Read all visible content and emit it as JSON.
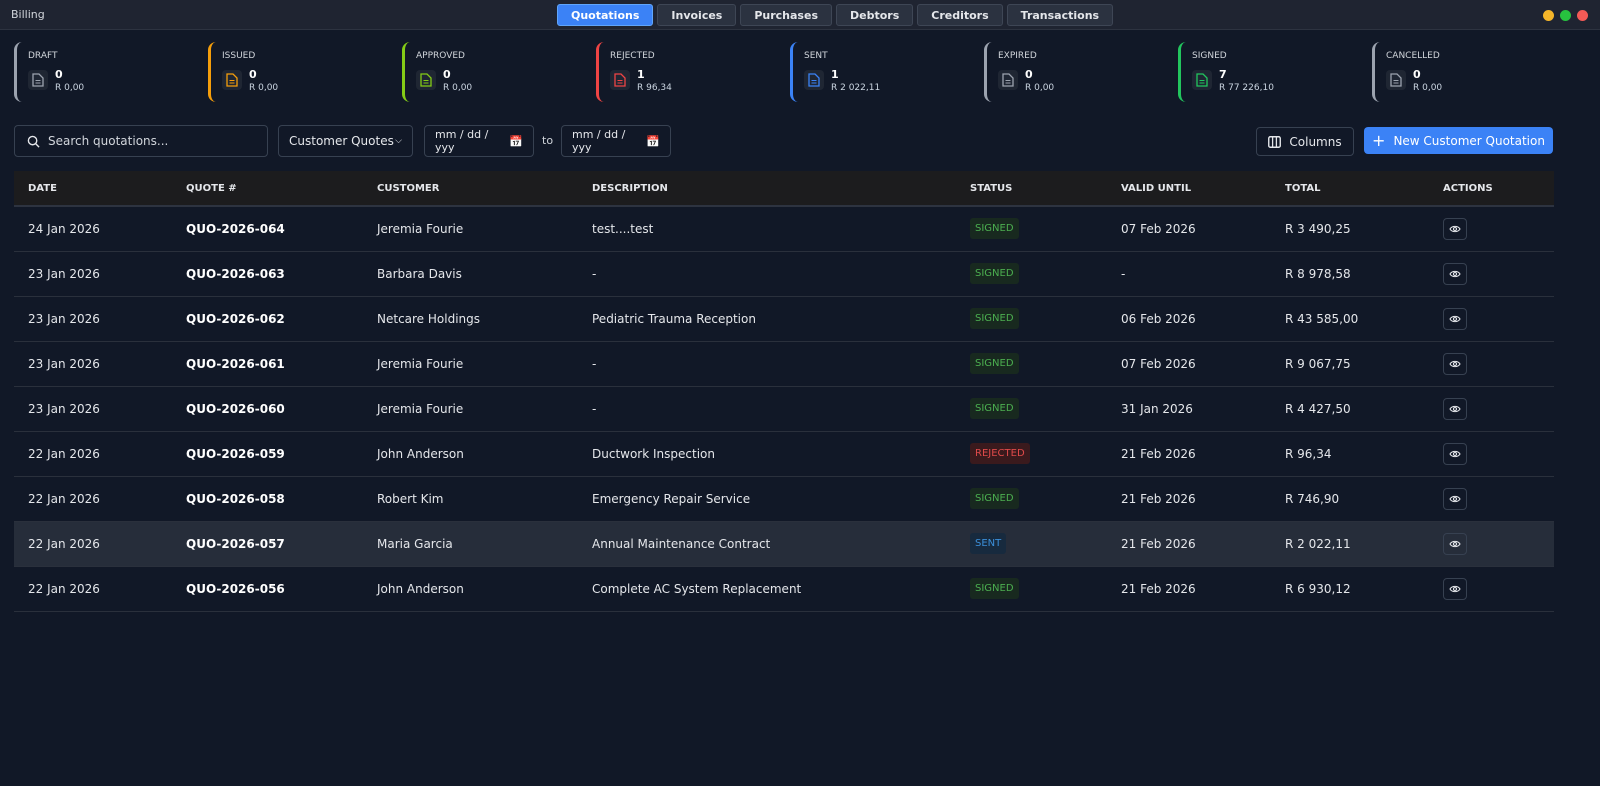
{
  "app": {
    "title": "Billing"
  },
  "tabs": [
    {
      "label": "Quotations",
      "active": true
    },
    {
      "label": "Invoices"
    },
    {
      "label": "Purchases"
    },
    {
      "label": "Debtors"
    },
    {
      "label": "Creditors"
    },
    {
      "label": "Transactions"
    }
  ],
  "window_controls": [
    {
      "name": "minimize",
      "color": "#f5b62a"
    },
    {
      "name": "maximize",
      "color": "#27c23f"
    },
    {
      "name": "close",
      "color": "#f25a56"
    }
  ],
  "stats": [
    {
      "label": "DRAFT",
      "count": "0",
      "amount": "R 0,00",
      "color": "#9ca3af",
      "icon": "document-icon"
    },
    {
      "label": "ISSUED",
      "count": "0",
      "amount": "R 0,00",
      "color": "#f59e0b",
      "icon": "document-icon"
    },
    {
      "label": "APPROVED",
      "count": "0",
      "amount": "R 0,00",
      "color": "#84cc16",
      "icon": "document-icon"
    },
    {
      "label": "REJECTED",
      "count": "1",
      "amount": "R 96,34",
      "color": "#ef4444",
      "icon": "document-icon"
    },
    {
      "label": "SENT",
      "count": "1",
      "amount": "R 2 022,11",
      "color": "#3b82f6",
      "icon": "document-icon"
    },
    {
      "label": "EXPIRED",
      "count": "0",
      "amount": "R 0,00",
      "color": "#9ca3af",
      "icon": "document-icon"
    },
    {
      "label": "SIGNED",
      "count": "7",
      "amount": "R 77 226,10",
      "color": "#22c55e",
      "icon": "document-icon"
    },
    {
      "label": "CANCELLED",
      "count": "0",
      "amount": "R 0,00",
      "color": "#9ca3af",
      "icon": "document-icon"
    }
  ],
  "toolbar": {
    "search_placeholder": "Search quotations...",
    "filter_value": "Customer Quotes",
    "date_from_placeholder": "mm / dd / yyy",
    "to_label": "to",
    "date_to_placeholder": "mm / dd / yyy",
    "columns_label": "Columns",
    "new_label": "New Customer Quotation"
  },
  "table": {
    "headers": [
      "DATE",
      "QUOTE #",
      "CUSTOMER",
      "DESCRIPTION",
      "STATUS",
      "VALID UNTIL",
      "TOTAL",
      "ACTIONS"
    ],
    "rows": [
      {
        "date": "24 Jan 2026",
        "quote": "QUO-2026-064",
        "customer": "Jeremia Fourie",
        "description": "test....test",
        "status": "SIGNED",
        "valid": "07 Feb 2026",
        "total": "R 3 490,25"
      },
      {
        "date": "23 Jan 2026",
        "quote": "QUO-2026-063",
        "customer": "Barbara Davis",
        "description": "-",
        "status": "SIGNED",
        "valid": "-",
        "total": "R 8 978,58"
      },
      {
        "date": "23 Jan 2026",
        "quote": "QUO-2026-062",
        "customer": "Netcare Holdings",
        "description": "Pediatric Trauma Reception",
        "status": "SIGNED",
        "valid": "06 Feb 2026",
        "total": "R 43 585,00"
      },
      {
        "date": "23 Jan 2026",
        "quote": "QUO-2026-061",
        "customer": "Jeremia Fourie",
        "description": "-",
        "status": "SIGNED",
        "valid": "07 Feb 2026",
        "total": "R 9 067,75"
      },
      {
        "date": "23 Jan 2026",
        "quote": "QUO-2026-060",
        "customer": "Jeremia Fourie",
        "description": "-",
        "status": "SIGNED",
        "valid": "31 Jan 2026",
        "total": "R 4 427,50"
      },
      {
        "date": "22 Jan 2026",
        "quote": "QUO-2026-059",
        "customer": "John Anderson",
        "description": "Ductwork Inspection",
        "status": "REJECTED",
        "valid": "21 Feb 2026",
        "total": "R 96,34"
      },
      {
        "date": "22 Jan 2026",
        "quote": "QUO-2026-058",
        "customer": "Robert Kim",
        "description": "Emergency Repair Service",
        "status": "SIGNED",
        "valid": "21 Feb 2026",
        "total": "R 746,90"
      },
      {
        "date": "22 Jan 2026",
        "quote": "QUO-2026-057",
        "customer": "Maria Garcia",
        "description": "Annual Maintenance Contract",
        "status": "SENT",
        "valid": "21 Feb 2026",
        "total": "R 2 022,11",
        "highlighted": true
      },
      {
        "date": "22 Jan 2026",
        "quote": "QUO-2026-056",
        "customer": "John Anderson",
        "description": "Complete AC System Replacement",
        "status": "SIGNED",
        "valid": "21 Feb 2026",
        "total": "R 6 930,12"
      }
    ]
  },
  "status_colors": {
    "SIGNED": {
      "fg": "#4caf50",
      "bg": "#18291f"
    },
    "REJECTED": {
      "fg": "#e04a4a",
      "bg": "#3a1a1d"
    },
    "SENT": {
      "fg": "#3b8fd9",
      "bg": "#172a3e"
    }
  }
}
